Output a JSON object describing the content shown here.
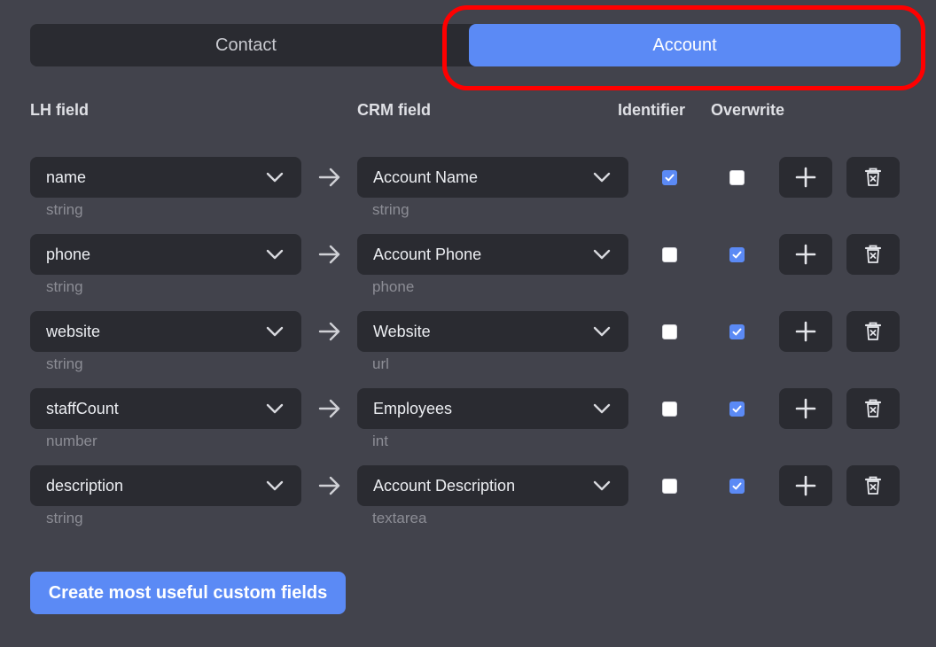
{
  "tabs": [
    {
      "label": "Contact",
      "active": false
    },
    {
      "label": "Account",
      "active": true
    }
  ],
  "columns": {
    "lh_field": "LH field",
    "crm_field": "CRM field",
    "identifier": "Identifier",
    "overwrite": "Overwrite"
  },
  "rows": [
    {
      "lh_field": "name",
      "lh_type": "string",
      "crm_field": "Account Name",
      "crm_type": "string",
      "identifier": true,
      "overwrite": false
    },
    {
      "lh_field": "phone",
      "lh_type": "string",
      "crm_field": "Account Phone",
      "crm_type": "phone",
      "identifier": false,
      "overwrite": true
    },
    {
      "lh_field": "website",
      "lh_type": "string",
      "crm_field": "Website",
      "crm_type": "url",
      "identifier": false,
      "overwrite": true
    },
    {
      "lh_field": "staffCount",
      "lh_type": "number",
      "crm_field": "Employees",
      "crm_type": "int",
      "identifier": false,
      "overwrite": true
    },
    {
      "lh_field": "description",
      "lh_type": "string",
      "crm_field": "Account Description",
      "crm_type": "textarea",
      "identifier": false,
      "overwrite": true
    }
  ],
  "create_button": {
    "label": "Create most useful custom fields"
  },
  "icons": {
    "dropdown": "chevron-down-icon",
    "mapping": "arrow-right-icon",
    "add": "plus-icon",
    "delete": "trash-icon"
  },
  "colors": {
    "accent": "#5b8af5",
    "highlight": "#ff0000",
    "background": "#42434c",
    "surface": "#2a2b31"
  }
}
